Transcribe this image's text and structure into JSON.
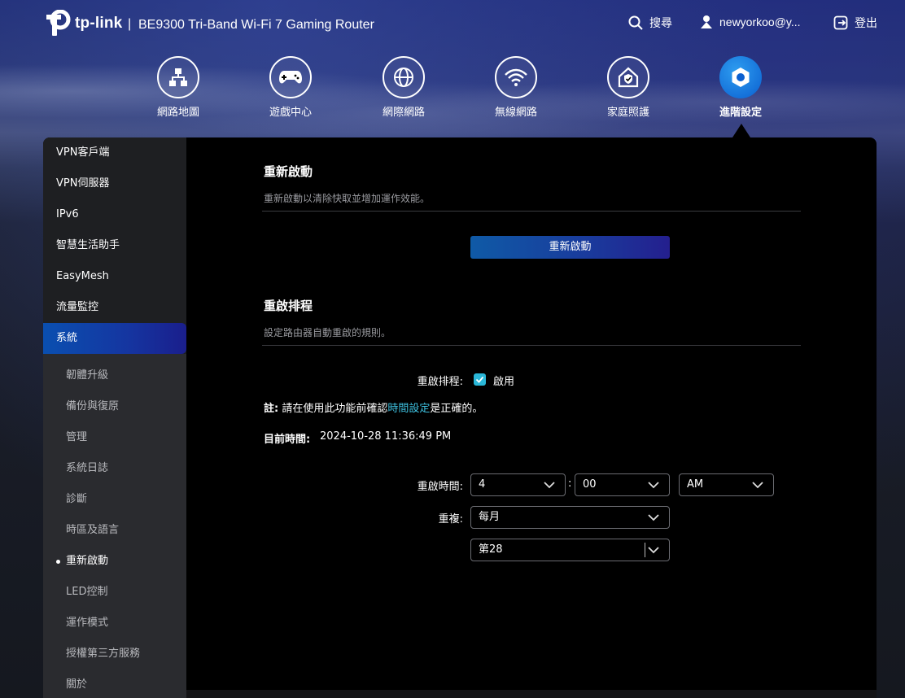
{
  "header": {
    "brand": "tp-link",
    "separator": "|",
    "model": "BE9300 Tri-Band Wi-Fi 7 Gaming Router",
    "search_label": "搜尋",
    "user_label": "newyorkoo@y...",
    "logout_label": "登出"
  },
  "nav": {
    "items": [
      {
        "label": "網路地圖",
        "icon": "network-map-icon"
      },
      {
        "label": "遊戲中心",
        "icon": "gamepad-icon"
      },
      {
        "label": "網際網路",
        "icon": "globe-icon"
      },
      {
        "label": "無線網路",
        "icon": "wifi-icon"
      },
      {
        "label": "家庭照護",
        "icon": "home-shield-icon"
      },
      {
        "label": "進階設定",
        "icon": "gear-icon",
        "active": true
      }
    ]
  },
  "sidebar": {
    "items": [
      {
        "label": "VPN客戶端"
      },
      {
        "label": "VPN伺服器"
      },
      {
        "label": "IPv6"
      },
      {
        "label": "智慧生活助手"
      },
      {
        "label": "EasyMesh"
      },
      {
        "label": "流量監控"
      },
      {
        "label": "系統",
        "active": true
      }
    ],
    "sub_items": [
      {
        "label": "韌體升級"
      },
      {
        "label": "備份與復原"
      },
      {
        "label": "管理"
      },
      {
        "label": "系統日誌"
      },
      {
        "label": "診斷"
      },
      {
        "label": "時區及語言"
      },
      {
        "label": "重新啟動",
        "current": true
      },
      {
        "label": "LED控制"
      },
      {
        "label": "運作模式"
      },
      {
        "label": "授權第三方服務"
      },
      {
        "label": "關於"
      }
    ]
  },
  "reboot": {
    "title": "重新啟動",
    "description": "重新啟動以清除快取並增加運作效能。",
    "button_label": "重新啟動"
  },
  "schedule": {
    "title": "重啟排程",
    "description": "設定路由器自動重啟的規則。",
    "enable_label": "重啟排程:",
    "enable_checkbox_label": "啟用",
    "enabled": true,
    "note_prefix": "註:",
    "note_text_1": " 請在使用此功能前確認",
    "note_link": "時間設定",
    "note_text_2": "是正確的。",
    "current_time_label": "目前時間:",
    "current_time_value": "2024-10-28 11:36:49 PM",
    "reboot_time_label": "重啟時間:",
    "hour_value": "4",
    "colon": ":",
    "minute_value": "00",
    "ampm_value": "AM",
    "repeat_label": "重複:",
    "repeat_value": "每月",
    "day_value": "第28"
  },
  "colors": {
    "accent": "#2ab7d8",
    "active_nav": "#0a5fd0",
    "button_gradient_start": "#0f5aa6",
    "button_gradient_end": "#241f8e"
  }
}
